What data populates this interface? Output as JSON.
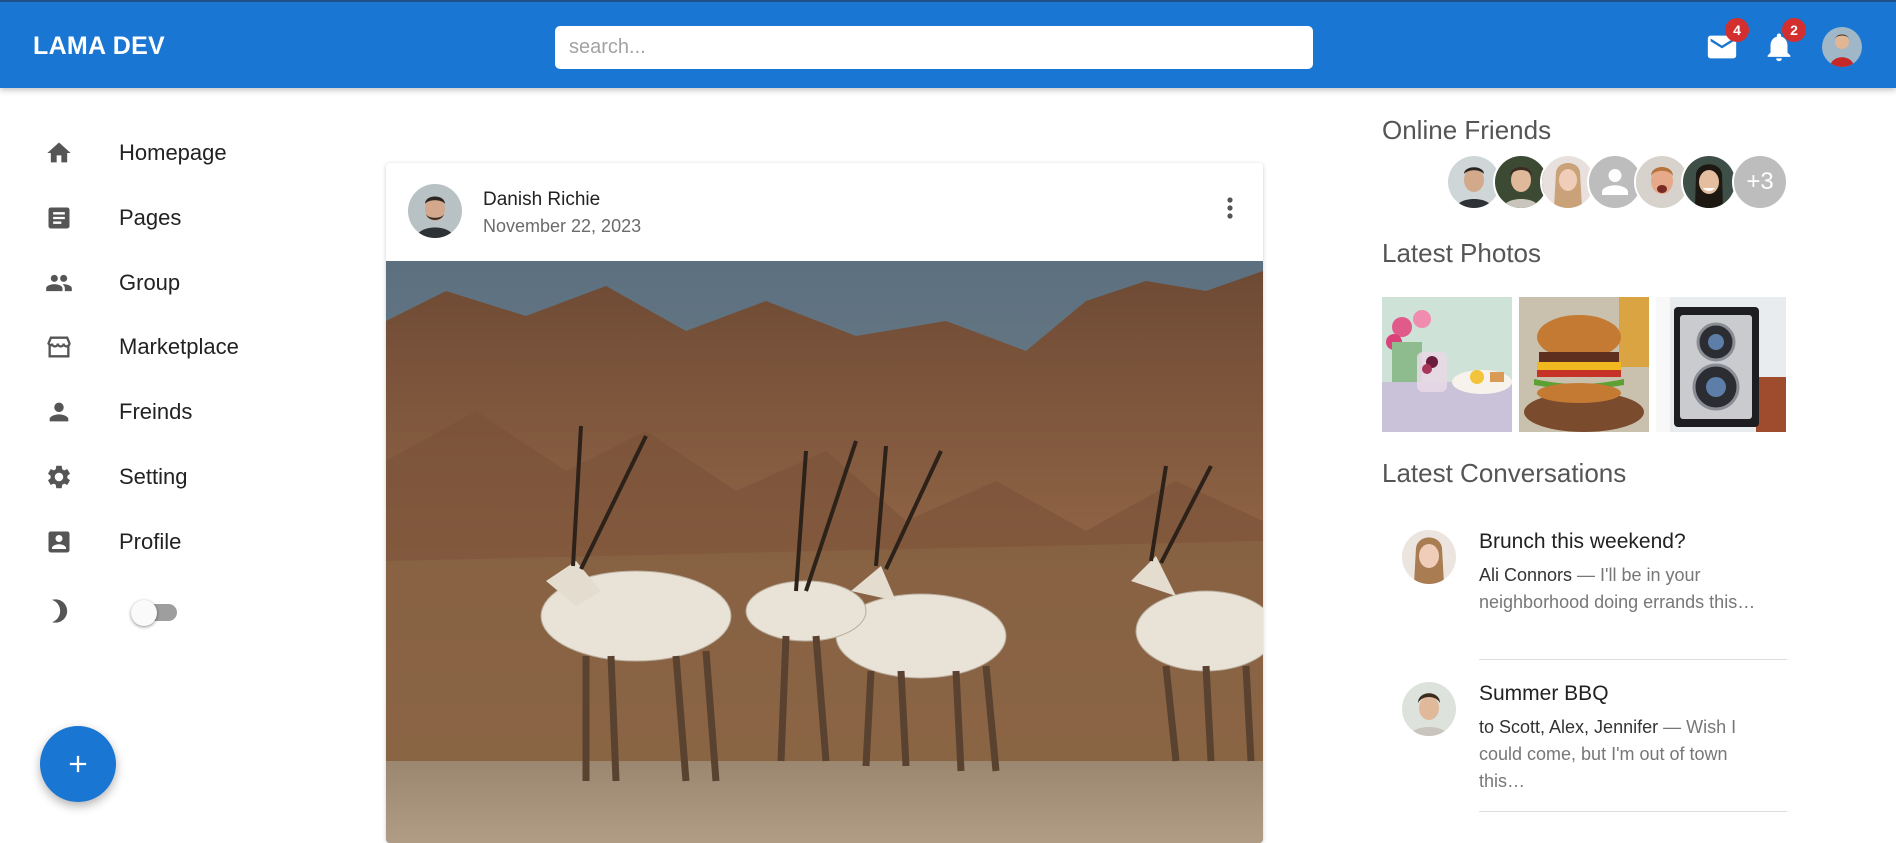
{
  "header": {
    "logo": "LAMA DEV",
    "search_placeholder": "search...",
    "mail_badge": "4",
    "notifications_badge": "2"
  },
  "sidebar": {
    "items": [
      {
        "label": "Homepage",
        "icon": "home-icon"
      },
      {
        "label": "Pages",
        "icon": "article-icon"
      },
      {
        "label": "Group",
        "icon": "group-icon"
      },
      {
        "label": "Marketplace",
        "icon": "storefront-icon"
      },
      {
        "label": "Freinds",
        "icon": "person-icon"
      },
      {
        "label": "Setting",
        "icon": "gear-icon"
      },
      {
        "label": "Profile",
        "icon": "account-box-icon"
      }
    ],
    "dark_mode_icon": "moon-icon",
    "fab_icon": "plus-icon"
  },
  "post": {
    "author": "Danish Richie",
    "date": "November 22, 2023"
  },
  "right_panel": {
    "online_friends_title": "Online Friends",
    "more_friends": "+3",
    "latest_photos_title": "Latest Photos",
    "latest_conversations_title": "Latest Conversations",
    "conversations": [
      {
        "title": "Brunch this weekend?",
        "who": "Ali Connors",
        "text": " — I'll be in your neighborhood doing errands this…"
      },
      {
        "title": "Summer BBQ",
        "who": "to Scott, Alex, Jennifer",
        "text": " — Wish I could come, but I'm out of town this…"
      }
    ]
  },
  "colors": {
    "primary": "#1976d2",
    "badge": "#d32f2f"
  }
}
